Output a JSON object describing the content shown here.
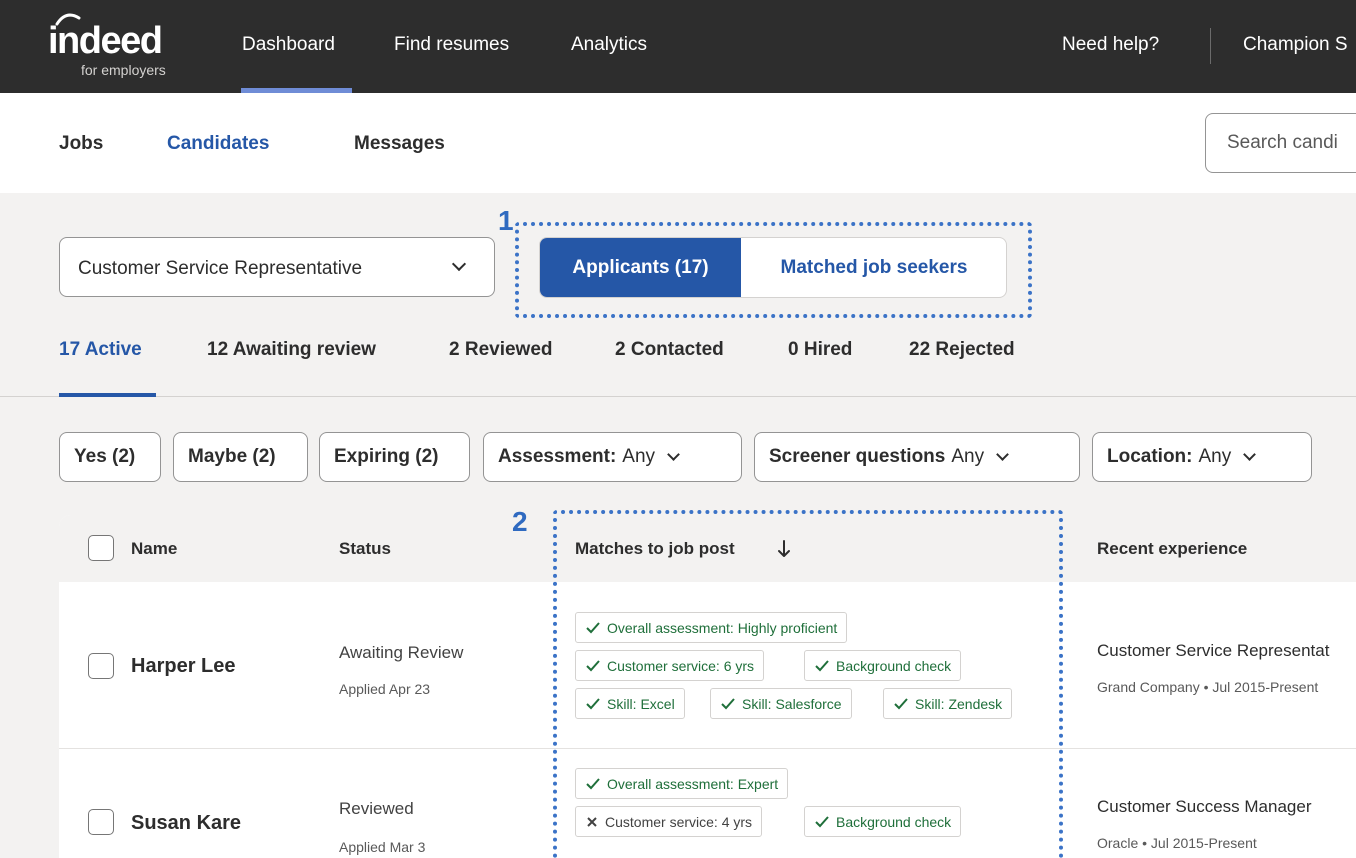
{
  "brand": {
    "word": "indeed",
    "sub": "for employers"
  },
  "topnav": {
    "links": [
      "Dashboard",
      "Find resumes",
      "Analytics"
    ],
    "help": "Need help?",
    "account": "Champion S"
  },
  "subnav": {
    "links": [
      "Jobs",
      "Candidates",
      "Messages"
    ],
    "search_placeholder": "Search candi"
  },
  "job_select": {
    "value": "Customer Service Representative"
  },
  "toggle": {
    "applicants": "Applicants (17)",
    "matched": "Matched job seekers"
  },
  "annotations": [
    "1",
    "2"
  ],
  "status_tabs": [
    "17 Active",
    "12 Awaiting review",
    "2 Reviewed",
    "2 Contacted",
    "0 Hired",
    "22 Rejected"
  ],
  "filters": {
    "yes": "Yes (2)",
    "maybe": "Maybe (2)",
    "expiring": "Expiring (2)",
    "assessment_label": "Assessment:",
    "assessment_value": "Any",
    "screener_label": "Screener questions",
    "screener_value": "Any",
    "location_label": "Location:",
    "location_value": "Any"
  },
  "table": {
    "headers": {
      "name": "Name",
      "status": "Status",
      "matches": "Matches to job post",
      "experience": "Recent experience"
    },
    "rows": [
      {
        "name": "Harper Lee",
        "status": "Awaiting Review",
        "applied": "Applied Apr 23",
        "matches": [
          {
            "text": "Overall assessment: Highly proficient",
            "ok": true
          },
          {
            "text": "Customer service: 6 yrs",
            "ok": true
          },
          {
            "text": "Background check",
            "ok": true
          },
          {
            "text": "Skill: Excel",
            "ok": true
          },
          {
            "text": "Skill: Salesforce",
            "ok": true
          },
          {
            "text": "Skill: Zendesk",
            "ok": true
          }
        ],
        "experience_title": "Customer Service Representat",
        "experience_sub": "Grand Company • Jul 2015-Present"
      },
      {
        "name": "Susan Kare",
        "status": "Reviewed",
        "applied": "Applied Mar 3",
        "matches": [
          {
            "text": "Overall assessment: Expert",
            "ok": true
          },
          {
            "text": "Customer service: 4 yrs",
            "ok": false
          },
          {
            "text": "Background check",
            "ok": true
          }
        ],
        "experience_title": "Customer Success Manager",
        "experience_sub": "Oracle • Jul 2015-Present"
      }
    ]
  },
  "colors": {
    "accent": "#2557a7",
    "nav_bg": "#2d2d2d",
    "match_green": "#1f6f3a",
    "annotation": "#3b73c7"
  },
  "icons": [
    "check-icon",
    "x-icon",
    "chevron-down-icon",
    "sort-down-arrow-icon"
  ]
}
